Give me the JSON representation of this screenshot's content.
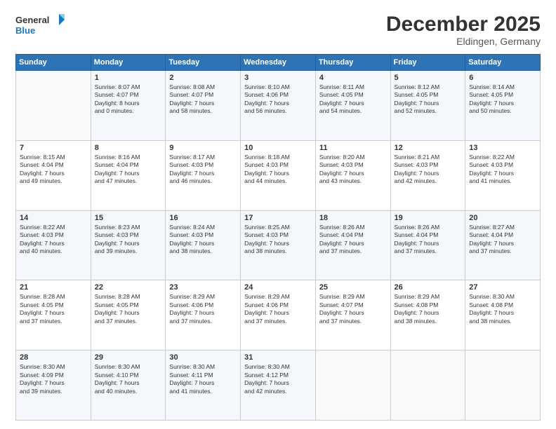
{
  "logo": {
    "line1": "General",
    "line2": "Blue"
  },
  "title": "December 2025",
  "location": "Eldingen, Germany",
  "days_of_week": [
    "Sunday",
    "Monday",
    "Tuesday",
    "Wednesday",
    "Thursday",
    "Friday",
    "Saturday"
  ],
  "weeks": [
    [
      {
        "num": "",
        "info": ""
      },
      {
        "num": "1",
        "info": "Sunrise: 8:07 AM\nSunset: 4:07 PM\nDaylight: 8 hours\nand 0 minutes."
      },
      {
        "num": "2",
        "info": "Sunrise: 8:08 AM\nSunset: 4:07 PM\nDaylight: 7 hours\nand 58 minutes."
      },
      {
        "num": "3",
        "info": "Sunrise: 8:10 AM\nSunset: 4:06 PM\nDaylight: 7 hours\nand 56 minutes."
      },
      {
        "num": "4",
        "info": "Sunrise: 8:11 AM\nSunset: 4:05 PM\nDaylight: 7 hours\nand 54 minutes."
      },
      {
        "num": "5",
        "info": "Sunrise: 8:12 AM\nSunset: 4:05 PM\nDaylight: 7 hours\nand 52 minutes."
      },
      {
        "num": "6",
        "info": "Sunrise: 8:14 AM\nSunset: 4:05 PM\nDaylight: 7 hours\nand 50 minutes."
      }
    ],
    [
      {
        "num": "7",
        "info": "Sunrise: 8:15 AM\nSunset: 4:04 PM\nDaylight: 7 hours\nand 49 minutes."
      },
      {
        "num": "8",
        "info": "Sunrise: 8:16 AM\nSunset: 4:04 PM\nDaylight: 7 hours\nand 47 minutes."
      },
      {
        "num": "9",
        "info": "Sunrise: 8:17 AM\nSunset: 4:03 PM\nDaylight: 7 hours\nand 46 minutes."
      },
      {
        "num": "10",
        "info": "Sunrise: 8:18 AM\nSunset: 4:03 PM\nDaylight: 7 hours\nand 44 minutes."
      },
      {
        "num": "11",
        "info": "Sunrise: 8:20 AM\nSunset: 4:03 PM\nDaylight: 7 hours\nand 43 minutes."
      },
      {
        "num": "12",
        "info": "Sunrise: 8:21 AM\nSunset: 4:03 PM\nDaylight: 7 hours\nand 42 minutes."
      },
      {
        "num": "13",
        "info": "Sunrise: 8:22 AM\nSunset: 4:03 PM\nDaylight: 7 hours\nand 41 minutes."
      }
    ],
    [
      {
        "num": "14",
        "info": "Sunrise: 8:22 AM\nSunset: 4:03 PM\nDaylight: 7 hours\nand 40 minutes."
      },
      {
        "num": "15",
        "info": "Sunrise: 8:23 AM\nSunset: 4:03 PM\nDaylight: 7 hours\nand 39 minutes."
      },
      {
        "num": "16",
        "info": "Sunrise: 8:24 AM\nSunset: 4:03 PM\nDaylight: 7 hours\nand 38 minutes."
      },
      {
        "num": "17",
        "info": "Sunrise: 8:25 AM\nSunset: 4:03 PM\nDaylight: 7 hours\nand 38 minutes."
      },
      {
        "num": "18",
        "info": "Sunrise: 8:26 AM\nSunset: 4:04 PM\nDaylight: 7 hours\nand 37 minutes."
      },
      {
        "num": "19",
        "info": "Sunrise: 8:26 AM\nSunset: 4:04 PM\nDaylight: 7 hours\nand 37 minutes."
      },
      {
        "num": "20",
        "info": "Sunrise: 8:27 AM\nSunset: 4:04 PM\nDaylight: 7 hours\nand 37 minutes."
      }
    ],
    [
      {
        "num": "21",
        "info": "Sunrise: 8:28 AM\nSunset: 4:05 PM\nDaylight: 7 hours\nand 37 minutes."
      },
      {
        "num": "22",
        "info": "Sunrise: 8:28 AM\nSunset: 4:05 PM\nDaylight: 7 hours\nand 37 minutes."
      },
      {
        "num": "23",
        "info": "Sunrise: 8:29 AM\nSunset: 4:06 PM\nDaylight: 7 hours\nand 37 minutes."
      },
      {
        "num": "24",
        "info": "Sunrise: 8:29 AM\nSunset: 4:06 PM\nDaylight: 7 hours\nand 37 minutes."
      },
      {
        "num": "25",
        "info": "Sunrise: 8:29 AM\nSunset: 4:07 PM\nDaylight: 7 hours\nand 37 minutes."
      },
      {
        "num": "26",
        "info": "Sunrise: 8:29 AM\nSunset: 4:08 PM\nDaylight: 7 hours\nand 38 minutes."
      },
      {
        "num": "27",
        "info": "Sunrise: 8:30 AM\nSunset: 4:08 PM\nDaylight: 7 hours\nand 38 minutes."
      }
    ],
    [
      {
        "num": "28",
        "info": "Sunrise: 8:30 AM\nSunset: 4:09 PM\nDaylight: 7 hours\nand 39 minutes."
      },
      {
        "num": "29",
        "info": "Sunrise: 8:30 AM\nSunset: 4:10 PM\nDaylight: 7 hours\nand 40 minutes."
      },
      {
        "num": "30",
        "info": "Sunrise: 8:30 AM\nSunset: 4:11 PM\nDaylight: 7 hours\nand 41 minutes."
      },
      {
        "num": "31",
        "info": "Sunrise: 8:30 AM\nSunset: 4:12 PM\nDaylight: 7 hours\nand 42 minutes."
      },
      {
        "num": "",
        "info": ""
      },
      {
        "num": "",
        "info": ""
      },
      {
        "num": "",
        "info": ""
      }
    ]
  ]
}
